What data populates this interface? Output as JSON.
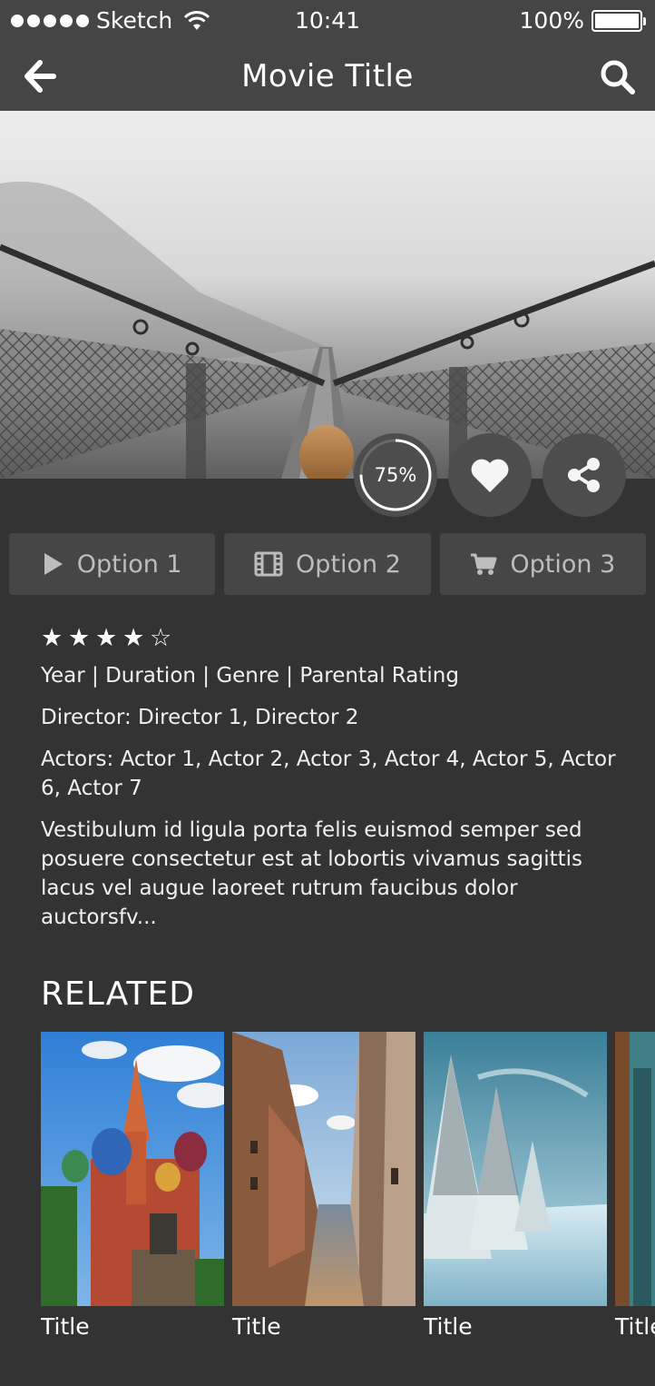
{
  "status_bar": {
    "carrier": "Sketch",
    "time": "10:41",
    "battery": "100%"
  },
  "nav": {
    "title": "Movie Title",
    "back_icon": "arrow-left-icon",
    "search_icon": "search-icon"
  },
  "hero": {
    "image": "foggy suspension bridge photo"
  },
  "actions": {
    "score": "75%",
    "score_fraction": 0.75,
    "favorite_icon": "heart-icon",
    "share_icon": "share-icon"
  },
  "options": [
    {
      "label": "Option 1",
      "icon": "play-icon"
    },
    {
      "label": "Option 2",
      "icon": "film-icon"
    },
    {
      "label": "Option 3",
      "icon": "cart-icon"
    }
  ],
  "details": {
    "rating_stars": 4,
    "rating_max": 5,
    "meta": "Year | Duration | Genre | Parental Rating",
    "director": "Director: Director 1, Director 2",
    "actors": "Actors: Actor 1, Actor 2, Actor 3, Actor 4, Actor 5, Actor 6, Actor 7",
    "synopsis": "Vestibulum id ligula porta felis euismod semper sed posuere consectetur est at lobortis vivamus sagittis lacus vel augue laoreet rutrum faucibus dolor auctorsfv..."
  },
  "related": {
    "heading": "RELATED",
    "items": [
      {
        "title": "Title"
      },
      {
        "title": "Title"
      },
      {
        "title": "Title"
      },
      {
        "title": "Title"
      }
    ]
  },
  "colors": {
    "background": "#333333",
    "bar": "#454545",
    "button": "#464646",
    "text": "#ffffff",
    "muted": "#bdbdbd"
  }
}
